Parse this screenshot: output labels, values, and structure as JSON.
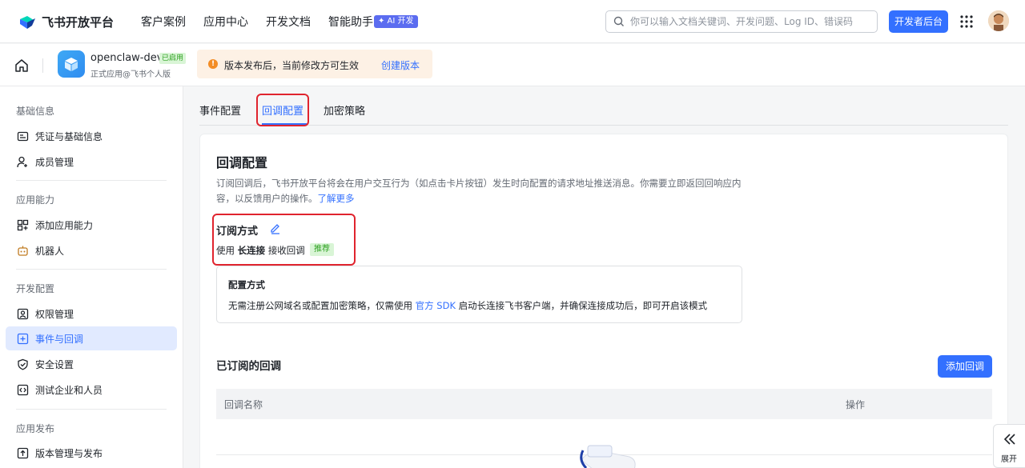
{
  "topnav": {
    "brand": "飞书开放平台",
    "links": [
      "客户案例",
      "应用中心",
      "开发文档",
      "智能助手"
    ],
    "ai_badge": "✦ AI 开发",
    "search_placeholder": "你可以输入文档关键词、开发问题、Log ID、错误码",
    "dev_console": "开发者后台"
  },
  "app": {
    "name": "openclaw-dev",
    "status": "已启用",
    "subtitle": "正式应用@飞书个人版",
    "notice": "版本发布后，当前修改方可生效",
    "notice_action": "创建版本"
  },
  "sidebar": {
    "sections": [
      {
        "title": "基础信息",
        "items": [
          "凭证与基础信息",
          "成员管理"
        ]
      },
      {
        "title": "应用能力",
        "items": [
          "添加应用能力",
          "机器人"
        ]
      },
      {
        "title": "开发配置",
        "items": [
          "权限管理",
          "事件与回调",
          "安全设置",
          "测试企业和人员"
        ]
      },
      {
        "title": "应用发布",
        "items": [
          "版本管理与发布"
        ]
      }
    ],
    "active": "事件与回调"
  },
  "tabs": [
    "事件配置",
    "回调配置",
    "加密策略"
  ],
  "active_tab": "回调配置",
  "card": {
    "title": "回调配置",
    "desc": "订阅回调后，飞书开放平台将会在用户交互行为（如点击卡片按钮）发生时向配置的请求地址推送消息。你需要立即返回回响应内容，以反馈用户的操作。",
    "desc_link": "了解更多",
    "sub_title": "订阅方式",
    "mode_prefix": "使用",
    "mode_bold": "长连接",
    "mode_suffix": "接收回调",
    "mode_badge": "推荐",
    "config_title": "配置方式",
    "config_text_a": "无需注册公网域名或配置加密策略，仅需使用",
    "config_link": "官方 SDK",
    "config_text_b": "启动长连接飞书客户端，并确保连接成功后，即可开启该模式",
    "subs_title": "已订阅的回调",
    "add_button": "添加回调",
    "columns": [
      "回调名称",
      "操作"
    ]
  },
  "expand_label": "展开",
  "colors": {
    "accent": "#3370ff",
    "highlight": "#e0242e"
  }
}
